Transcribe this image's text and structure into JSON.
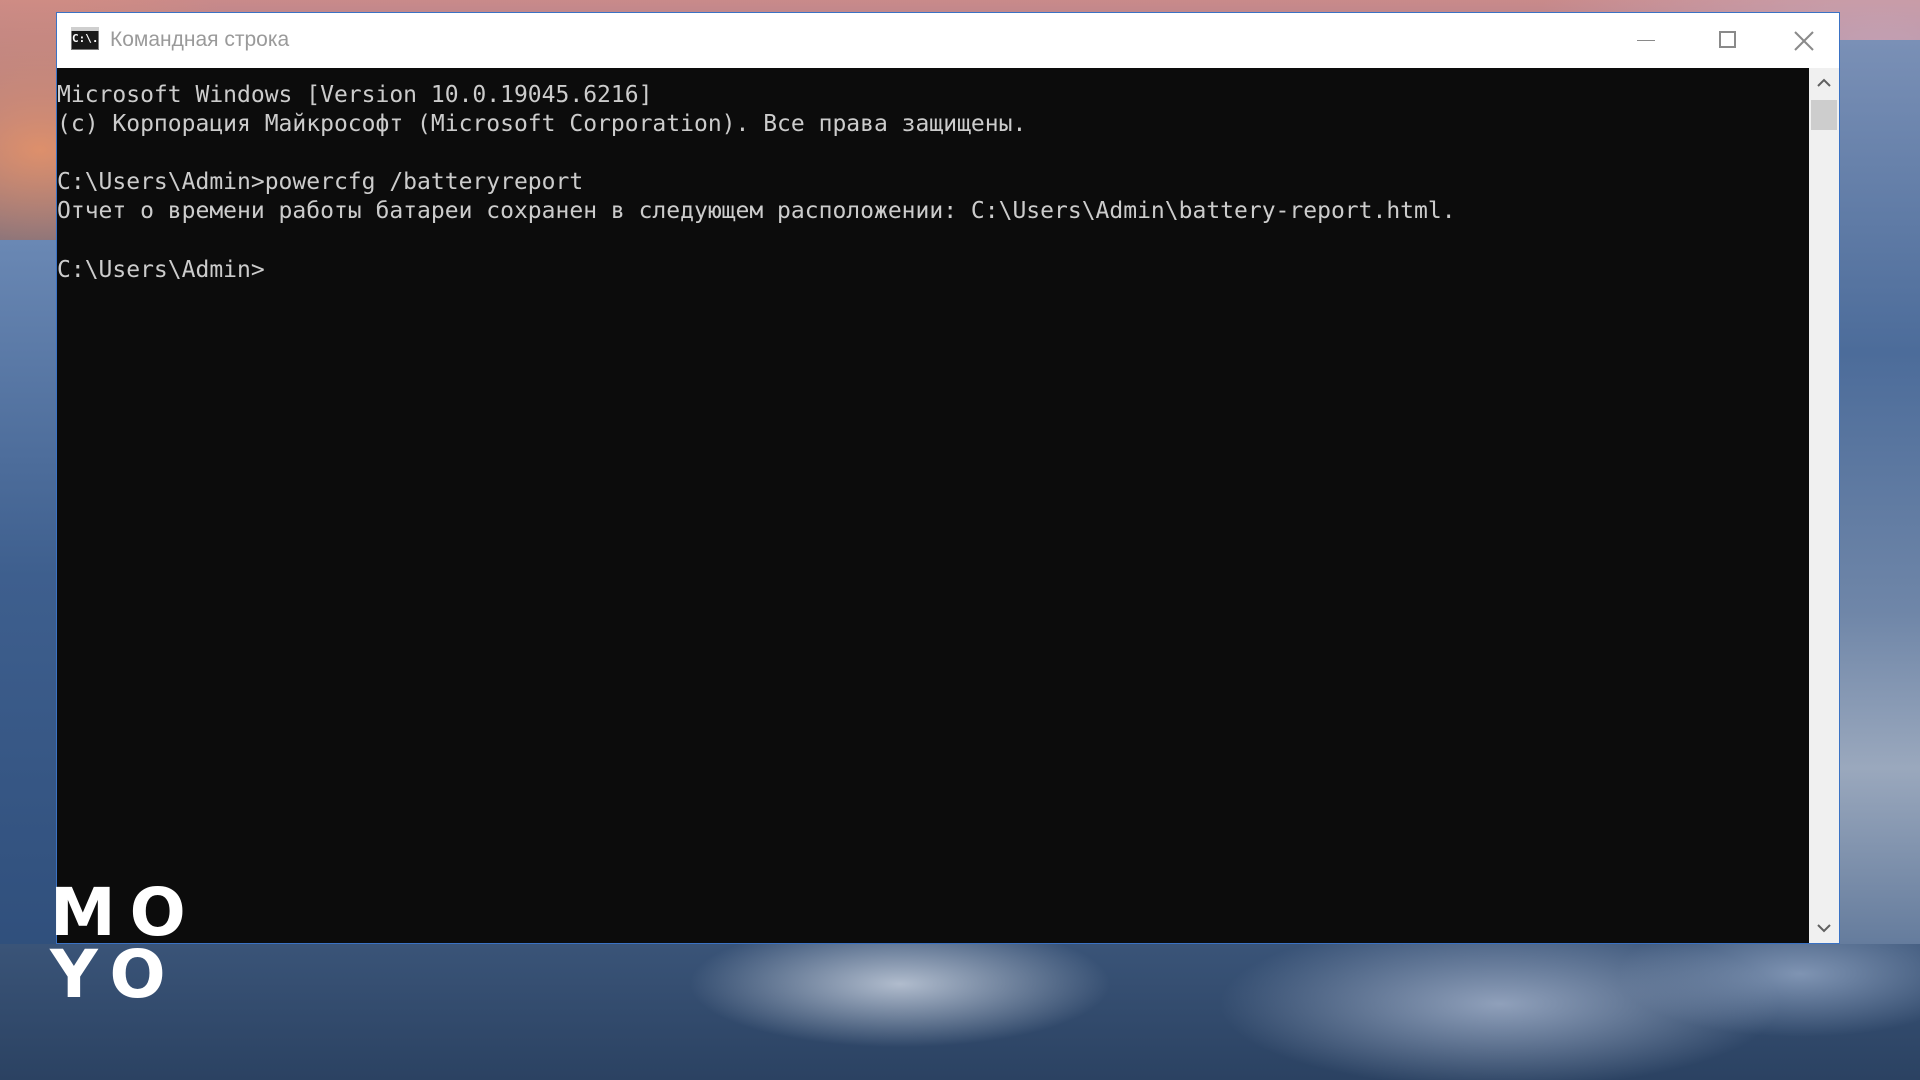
{
  "window": {
    "title": "Командная строка",
    "icon": "cmd-icon",
    "icon_text": "C:\\.",
    "accent_border_color": "#3a72c4"
  },
  "console": {
    "background_color": "#0c0c0c",
    "text_color": "#cccccc",
    "lines": [
      "Microsoft Windows [Version 10.0.19045.6216]",
      "(c) Корпорация Майкрософт (Microsoft Corporation). Все права защищены.",
      "C:\\Users\\Admin>powercfg /batteryreport",
      "Отчет о времени работы батареи сохранен в следующем расположении: C:\\Users\\Admin\\battery-report.html.",
      "C:\\Users\\Admin>"
    ]
  },
  "controls": {
    "minimize": "minimize-icon",
    "maximize": "maximize-icon",
    "close": "close-icon"
  },
  "scrollbar": {
    "up": "chevron-up-icon",
    "down": "chevron-down-icon"
  },
  "watermark": {
    "row1": "MO",
    "row2": "YO"
  }
}
